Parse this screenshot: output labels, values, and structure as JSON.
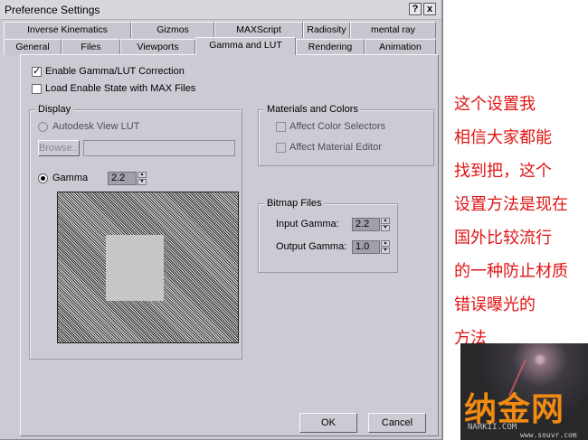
{
  "window": {
    "title": "Preference Settings",
    "help_label": "?",
    "close_label": "x"
  },
  "tabs_row1": [
    {
      "label": "Inverse Kinematics"
    },
    {
      "label": "Gizmos"
    },
    {
      "label": "MAXScript"
    },
    {
      "label": "Radiosity"
    },
    {
      "label": "mental ray"
    }
  ],
  "tabs_row2": [
    {
      "label": "General"
    },
    {
      "label": "Files"
    },
    {
      "label": "Viewports"
    },
    {
      "label": "Gamma and LUT",
      "active": true
    },
    {
      "label": "Rendering"
    },
    {
      "label": "Animation"
    }
  ],
  "options": {
    "enable_gamma_lut": {
      "label": "Enable Gamma/LUT Correction",
      "checked": true
    },
    "load_enable_state": {
      "label": "Load Enable State with MAX Files",
      "checked": false
    }
  },
  "display": {
    "title": "Display",
    "autodesk_lut_label": "Autodesk View LUT",
    "browse_label": "Browse...",
    "lut_path": "",
    "gamma_label": "Gamma",
    "gamma_value": "2.2",
    "selected_mode": "Gamma"
  },
  "materials_colors": {
    "title": "Materials and Colors",
    "affect_color_selectors": {
      "label": "Affect Color Selectors",
      "checked": false
    },
    "affect_material_editor": {
      "label": "Affect Material Editor",
      "checked": false
    }
  },
  "bitmap_files": {
    "title": "Bitmap Files",
    "input_gamma_label": "Input Gamma:",
    "input_gamma_value": "2.2",
    "output_gamma_label": "Output Gamma:",
    "output_gamma_value": "1.0"
  },
  "buttons": {
    "ok_label": "OK",
    "cancel_label": "Cancel"
  },
  "annotation": {
    "lines": [
      "这个设置我",
      "相信大家都能",
      "找到把，这个",
      "设置方法是现在",
      "国外比较流行",
      "的一种防止材质",
      "错误曝光的",
      "方法"
    ],
    "color": "#e11414"
  },
  "watermark": {
    "brand": "纳金网",
    "sub": "NARKII.COM",
    "url": "www.souvr.com"
  }
}
